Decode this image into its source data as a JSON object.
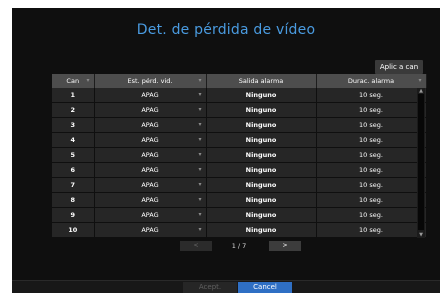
{
  "dialog": {
    "title": "Det. de pérdida de vídeo",
    "apply_all_label": "Aplic a can"
  },
  "table": {
    "columns": [
      "Can",
      "Est. pérd. vid.",
      "Salida alarma",
      "Durac. alarma"
    ],
    "rows": [
      {
        "channel": "1",
        "status": "APAG",
        "output": "Ninguno",
        "duration": "10 seg."
      },
      {
        "channel": "2",
        "status": "APAG",
        "output": "Ninguno",
        "duration": "10 seg."
      },
      {
        "channel": "3",
        "status": "APAG",
        "output": "Ninguno",
        "duration": "10 seg."
      },
      {
        "channel": "4",
        "status": "APAG",
        "output": "Ninguno",
        "duration": "10 seg."
      },
      {
        "channel": "5",
        "status": "APAG",
        "output": "Ninguno",
        "duration": "10 seg."
      },
      {
        "channel": "6",
        "status": "APAG",
        "output": "Ninguno",
        "duration": "10 seg."
      },
      {
        "channel": "7",
        "status": "APAG",
        "output": "Ninguno",
        "duration": "10 seg."
      },
      {
        "channel": "8",
        "status": "APAG",
        "output": "Ninguno",
        "duration": "10 seg."
      },
      {
        "channel": "9",
        "status": "APAG",
        "output": "Ninguno",
        "duration": "10 seg."
      },
      {
        "channel": "10",
        "status": "APAG",
        "output": "Ninguno",
        "duration": "10 seg."
      }
    ]
  },
  "pager": {
    "prev_label": "<",
    "page_text": "1 / 7",
    "next_label": ">"
  },
  "footer": {
    "accept_label": "Acept.",
    "cancel_label": "Cancel"
  },
  "icons": {
    "dropdown": "chevron-down-icon",
    "scroll_up": "scroll-up-icon",
    "scroll_down": "scroll-down-icon"
  },
  "colors": {
    "background": "#0f0f0f",
    "title": "#4a9be0",
    "header": "#4d4d4d",
    "cell": "#262626",
    "accent": "#2f6fc4"
  }
}
